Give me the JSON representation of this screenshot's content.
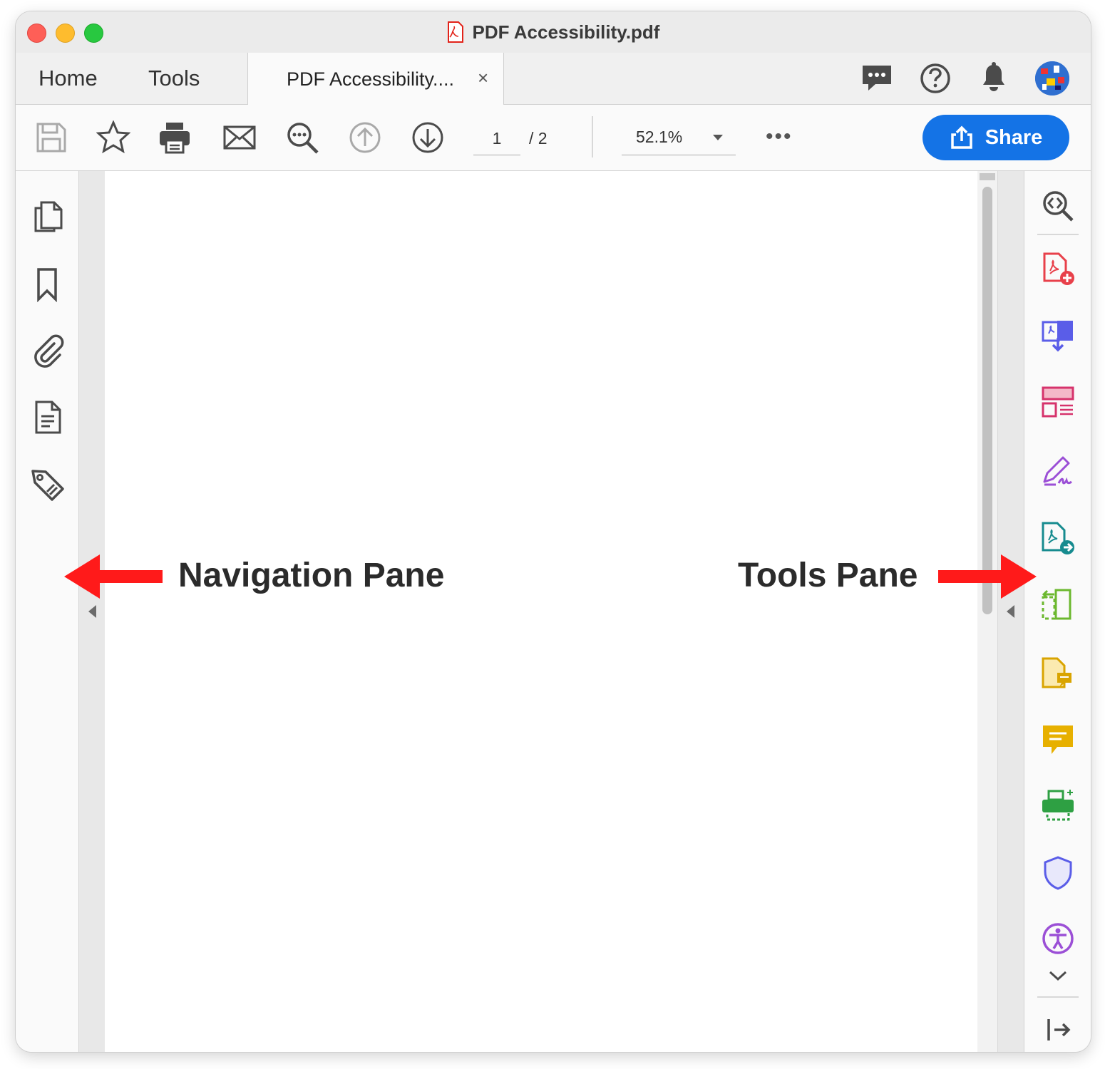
{
  "window": {
    "title": "PDF Accessibility.pdf"
  },
  "tabs": {
    "home": "Home",
    "tools": "Tools",
    "document": "PDF Accessibility....",
    "close_glyph": "×"
  },
  "toolbar": {
    "current_page": "1",
    "total_pages": "/ 2",
    "zoom": "52.1%",
    "more": "•••",
    "share_label": "Share"
  },
  "annotations": {
    "navigation_pane": "Navigation Pane",
    "tools_pane": "Tools Pane",
    "arrow_color": "#ff1a1a"
  },
  "colors": {
    "accent": "#1473e6"
  }
}
